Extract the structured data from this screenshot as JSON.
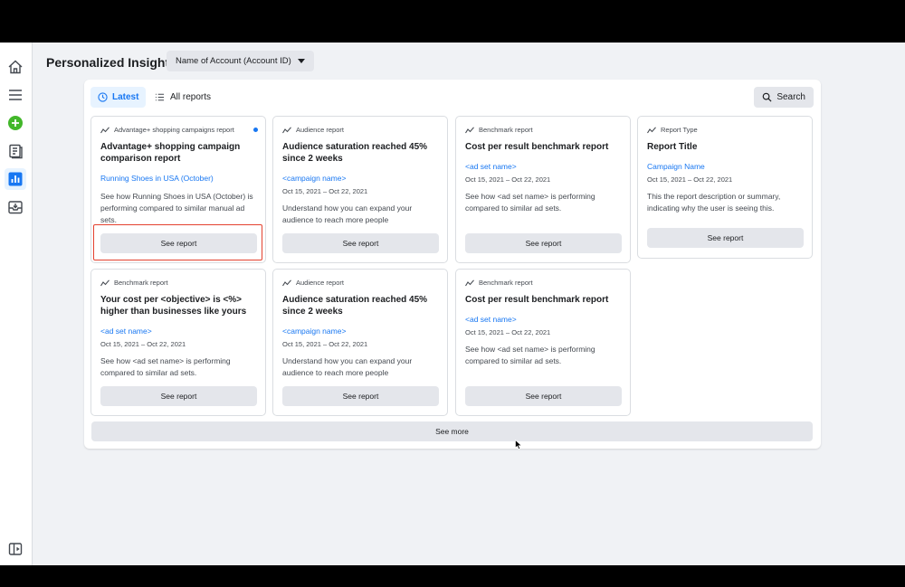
{
  "header": {
    "title": "Personalized Insights",
    "account_select": "Name of Account (Account ID)"
  },
  "sidebar": {
    "items": [
      {
        "icon": "home-icon"
      },
      {
        "icon": "menu-icon"
      },
      {
        "icon": "create-plus-icon",
        "color": "#42b72a"
      },
      {
        "icon": "pages-icon"
      },
      {
        "icon": "insights-chart-icon",
        "active": true
      },
      {
        "icon": "download-tray-icon"
      },
      {
        "icon": "collapse-panel-icon"
      }
    ]
  },
  "toolbar": {
    "latest_label": "Latest",
    "all_reports_label": "All reports",
    "search_label": "Search"
  },
  "cards": [
    {
      "type": "Advantage+ shopping campaigns report",
      "title": "Advantage+ shopping campaign comparison report",
      "link": "Running Shoes in USA (October)",
      "date": "",
      "description": "See how Running Shoes in USA (October) is performing compared to similar manual ad sets.",
      "button": "See report",
      "unread": true,
      "highlighted": true
    },
    {
      "type": "Audience report",
      "title": "Audience saturation reached 45% since 2 weeks",
      "link": "<campaign name>",
      "date": "Oct 15, 2021 – Oct 22, 2021",
      "description": "Understand how you can expand your audience to reach more people",
      "button": "See report"
    },
    {
      "type": "Benchmark report",
      "title": "Cost per result benchmark report",
      "link": "<ad set name>",
      "date": "Oct 15, 2021 – Oct 22, 2021",
      "description": "See how <ad set name> is performing compared to similar ad sets.",
      "button": "See report"
    },
    {
      "type": "Report Type",
      "title": "Report Title",
      "link": "Campaign Name",
      "date": "Oct 15, 2021 – Oct 22, 2021",
      "description": "This the report description or summary, indicating why the user is seeing this.",
      "button": "See report"
    },
    {
      "type": "Benchmark report",
      "title": "Your cost per <objective> is <%> higher than businesses like yours",
      "link": "<ad set name>",
      "date": "Oct 15, 2021 – Oct 22, 2021",
      "description": "See how <ad set name> is performing compared to similar ad sets.",
      "button": "See report"
    },
    {
      "type": "Audience report",
      "title": "Audience saturation reached 45% since 2 weeks",
      "link": "<campaign name>",
      "date": "Oct 15, 2021 – Oct 22, 2021",
      "description": "Understand how you can expand your audience to reach more people",
      "button": "See report"
    },
    {
      "type": "Benchmark report",
      "title": "Cost per result benchmark report",
      "link": "<ad set name>",
      "date": "Oct 15, 2021 – Oct 22, 2021",
      "description": "See how <ad set name> is performing compared to similar ad sets.",
      "button": "See report"
    }
  ],
  "see_more_label": "See more",
  "colors": {
    "accent": "#1877f2",
    "highlight": "#e4412f",
    "create": "#42b72a"
  }
}
